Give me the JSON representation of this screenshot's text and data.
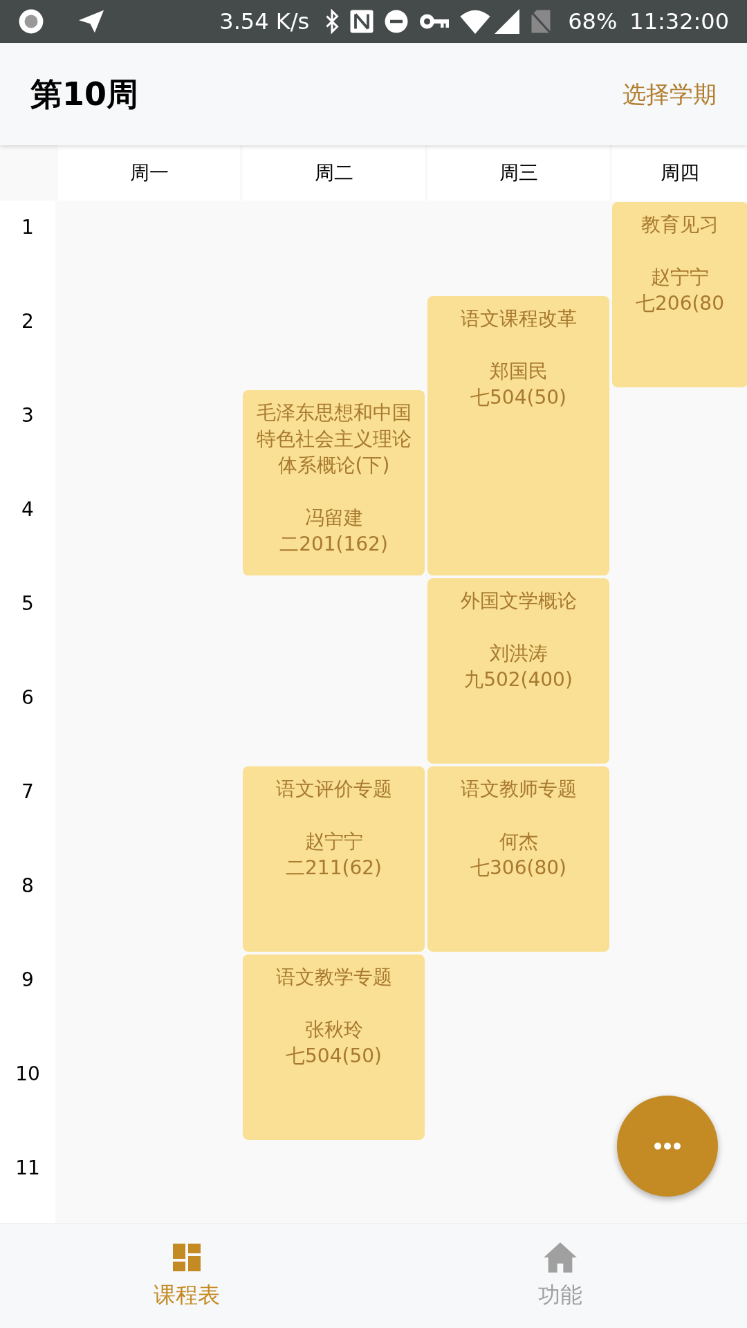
{
  "status_bar": {
    "speed": "3.54 K/s",
    "battery": "68%",
    "time": "11:32:00"
  },
  "header": {
    "title": "第10周",
    "action": "选择学期"
  },
  "days": [
    "周一",
    "周二",
    "周三",
    "周四"
  ],
  "periods": [
    "1",
    "2",
    "3",
    "4",
    "5",
    "6",
    "7",
    "8",
    "9",
    "10",
    "11"
  ],
  "courses": [
    {
      "title": "教育见习",
      "teacher": "赵宁宁",
      "room": "七206(80"
    },
    {
      "title": "语文课程改革",
      "teacher": "郑国民",
      "room": "七504(50)"
    },
    {
      "title": "毛泽东思想和中国特色社会主义理论体系概论(下)",
      "teacher": "冯留建",
      "room": "二201(162)"
    },
    {
      "title": "外国文学概论",
      "teacher": "刘洪涛",
      "room": "九502(400)"
    },
    {
      "title": "语文评价专题",
      "teacher": "赵宁宁",
      "room": "二211(62)"
    },
    {
      "title": "语文教师专题",
      "teacher": "何杰",
      "room": "七306(80)"
    },
    {
      "title": "语文教学专题",
      "teacher": "张秋玲",
      "room": "七504(50)"
    }
  ],
  "nav": [
    {
      "kind": "schedule",
      "label": "课程表",
      "selected": true
    },
    {
      "kind": "home",
      "label": "功能",
      "selected": false
    }
  ]
}
